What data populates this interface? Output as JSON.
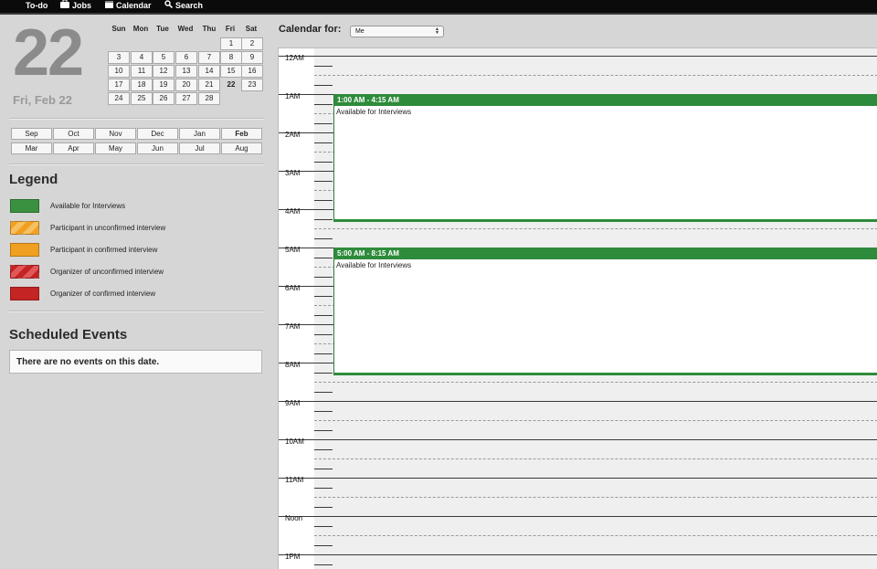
{
  "nav": {
    "items": [
      {
        "label": "To-do",
        "icon": "none"
      },
      {
        "label": "Jobs",
        "icon": "briefcase-icon"
      },
      {
        "label": "Calendar",
        "icon": "calendar-icon"
      },
      {
        "label": "Search",
        "icon": "search-icon"
      }
    ]
  },
  "date": {
    "big_day": "22",
    "sub": "Fri, Feb 22"
  },
  "mini_calendar": {
    "days_of_week": [
      "Sun",
      "Mon",
      "Tue",
      "Wed",
      "Thu",
      "Fri",
      "Sat"
    ],
    "weeks": [
      [
        "",
        "",
        "",
        "",
        "",
        "1",
        "2"
      ],
      [
        "3",
        "4",
        "5",
        "6",
        "7",
        "8",
        "9"
      ],
      [
        "10",
        "11",
        "12",
        "13",
        "14",
        "15",
        "16"
      ],
      [
        "17",
        "18",
        "19",
        "20",
        "21",
        "22",
        "23"
      ],
      [
        "24",
        "25",
        "26",
        "27",
        "28",
        "",
        ""
      ]
    ],
    "selected": "22"
  },
  "months": {
    "row1": [
      "Sep",
      "Oct",
      "Nov",
      "Dec",
      "Jan",
      "Feb"
    ],
    "row2": [
      "Mar",
      "Apr",
      "May",
      "Jun",
      "Jul",
      "Aug"
    ],
    "selected": "Feb"
  },
  "legend": {
    "title": "Legend",
    "items": [
      {
        "label": "Available for Interviews",
        "color": "#3a913f",
        "striped": false
      },
      {
        "label": "Participant in unconfirmed interview",
        "color": "#f0a020",
        "striped": true
      },
      {
        "label": "Participant in confirmed interview",
        "color": "#f0a020",
        "striped": false
      },
      {
        "label": "Organizer of unconfirmed interview",
        "color": "#c42424",
        "striped": true
      },
      {
        "label": "Organizer of confirmed interview",
        "color": "#c42424",
        "striped": false
      }
    ]
  },
  "scheduled": {
    "title": "Scheduled Events",
    "empty_text": "There are no events on this date."
  },
  "calendar_for": {
    "label": "Calendar for:",
    "selected": "Me"
  },
  "hours": [
    "12AM",
    "1AM",
    "2AM",
    "3AM",
    "4AM",
    "5AM",
    "6AM",
    "7AM",
    "8AM",
    "9AM",
    "10AM",
    "11AM",
    "Noon",
    "1PM"
  ],
  "events": [
    {
      "time": "1:00 AM - 4:15 AM",
      "title": "Available for Interviews",
      "start_hour": 1.0,
      "end_hour": 4.25
    },
    {
      "time": "5:00 AM - 8:15 AM",
      "title": "Available for Interviews",
      "start_hour": 5.0,
      "end_hour": 8.25
    }
  ],
  "colors": {
    "available": "#2e8b3b",
    "topbar": "#0b0b0b"
  }
}
